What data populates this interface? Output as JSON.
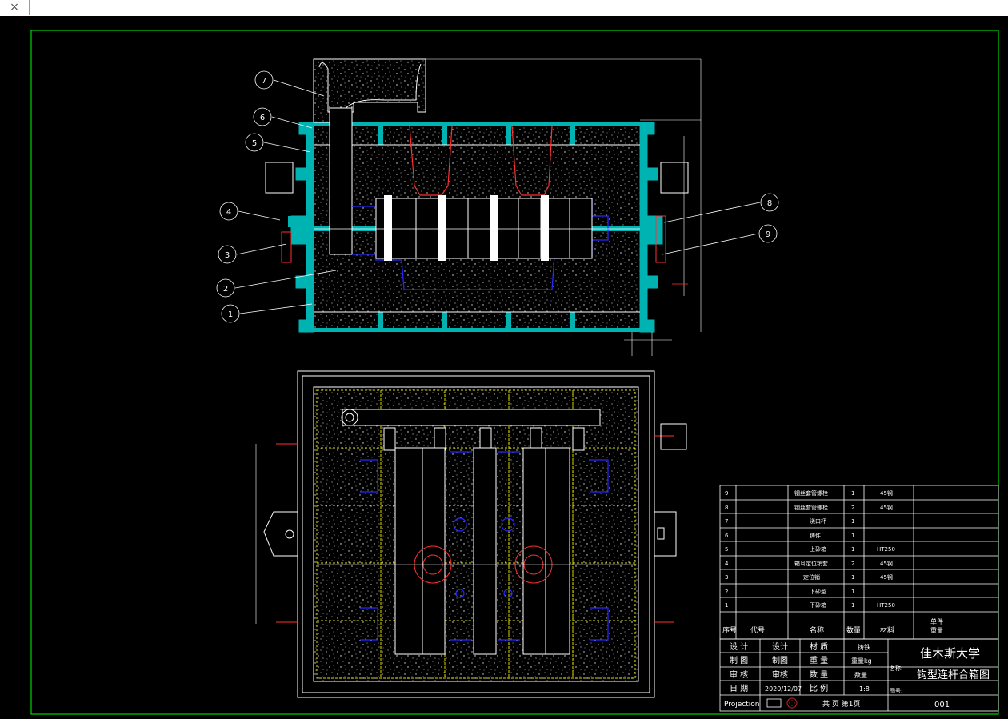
{
  "window": {
    "close_glyph": "×"
  },
  "balloons": [
    "7",
    "6",
    "5",
    "4",
    "3",
    "2",
    "1",
    "8",
    "9"
  ],
  "parts": [
    {
      "no": "9",
      "name": "钢丝套管螺栓",
      "qty": "1",
      "material": "45钢"
    },
    {
      "no": "8",
      "name": "钢丝套管螺栓",
      "qty": "2",
      "material": "45钢"
    },
    {
      "no": "7",
      "name": "浇口杯",
      "qty": "1",
      "material": ""
    },
    {
      "no": "6",
      "name": "铸件",
      "qty": "1",
      "material": ""
    },
    {
      "no": "5",
      "name": "上砂箱",
      "qty": "1",
      "material": "HT250"
    },
    {
      "no": "4",
      "name": "箱耳定位销套",
      "qty": "2",
      "material": "45钢"
    },
    {
      "no": "3",
      "name": "定位销",
      "qty": "1",
      "material": "45钢"
    },
    {
      "no": "2",
      "name": "下砂型",
      "qty": "1",
      "material": ""
    },
    {
      "no": "1",
      "name": "下砂箱",
      "qty": "1",
      "material": "HT250"
    }
  ],
  "table_header": {
    "no": "序号",
    "code": "代号",
    "name": "名称",
    "qty": "数量",
    "material": "材料",
    "note1": "单件",
    "note2": "重量"
  },
  "title_block": {
    "design": "设 计",
    "design_v": "设计",
    "mat": "材 质",
    "mat_v": "铸铁",
    "draw": "制 图",
    "draw_v": "制图",
    "weight": "重 量",
    "weight_v": "重量kg",
    "check": "审 核",
    "check_v": "审核",
    "qty": "数 量",
    "qty_v": "数量",
    "date": "日 期",
    "date_v": "2020/12/07",
    "scale": "比 例",
    "scale_v": "1:8",
    "school": "佳木斯大学",
    "drawing_name": "钩型连杆合箱图",
    "name_label": "名称:",
    "projection": "Projection",
    "sheets": "共 页 第1页",
    "no_label": "图号:",
    "code": "001"
  },
  "colors": {
    "frame": "#00ff00",
    "flask": "#00b3b3",
    "part": "#ffffff",
    "casting": "#ff3030",
    "core": "#2828ff",
    "gate": "#d9d900"
  }
}
